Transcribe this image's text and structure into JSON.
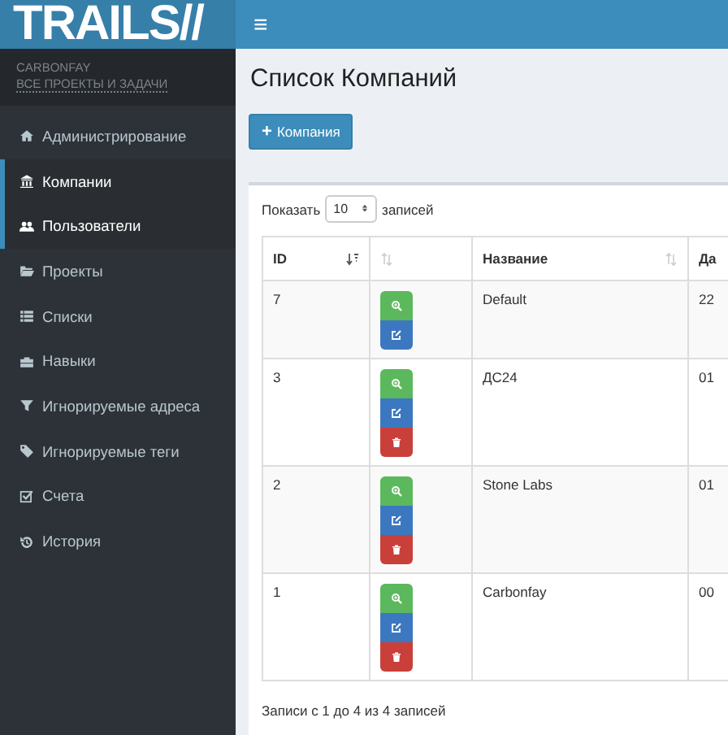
{
  "header": {
    "logo": "TRAILS//",
    "menu_toggle": "≡"
  },
  "sidebar": {
    "user": {
      "name": "CARBONFAY",
      "link": "ВСЕ ПРОЕКТЫ И ЗАДАЧИ"
    },
    "items": [
      {
        "label": "Администрирование",
        "selected": false
      },
      {
        "label": "Компании",
        "selected": true
      },
      {
        "label": "Пользователи",
        "selected": true
      },
      {
        "label": "Проекты",
        "selected": false
      },
      {
        "label": "Списки",
        "selected": false
      },
      {
        "label": "Навыки",
        "selected": false
      },
      {
        "label": "Игнорируемые адреса",
        "selected": false
      },
      {
        "label": "Игнорируемые теги",
        "selected": false
      },
      {
        "label": "Счета",
        "selected": false
      },
      {
        "label": "История",
        "selected": false
      }
    ]
  },
  "page_title": "Список Компаний",
  "add_button": {
    "icon": "+",
    "label": "Компания"
  },
  "table": {
    "length_label_before": "Показать",
    "length_value": "10",
    "length_label_after": "записей",
    "columns": [
      {
        "label": "ID",
        "sorted": true
      },
      {
        "sorted": false
      },
      {
        "label": "Название",
        "sorted": false
      },
      {
        "label": "Да"
      }
    ],
    "rows": [
      {
        "id": "7",
        "actions": [
          {
            "kind": "view"
          },
          {
            "kind": "edit"
          }
        ],
        "name": "Default",
        "column_4": "22"
      },
      {
        "id": "3",
        "actions": [
          {
            "kind": "view"
          },
          {
            "kind": "edit"
          },
          {
            "kind": "delete"
          }
        ],
        "name": "ДС24",
        "column_4": "01"
      },
      {
        "id": "2",
        "actions": [
          {
            "kind": "view"
          },
          {
            "kind": "edit"
          },
          {
            "kind": "delete"
          }
        ],
        "name": "Stone Labs",
        "column_4": "01"
      },
      {
        "id": "1",
        "actions": [
          {
            "kind": "view"
          },
          {
            "kind": "edit"
          },
          {
            "kind": "delete"
          }
        ],
        "name": "Carbonfay",
        "column_4": "00"
      }
    ],
    "info": "Записи с 1 до 4 из 4 записей"
  }
}
